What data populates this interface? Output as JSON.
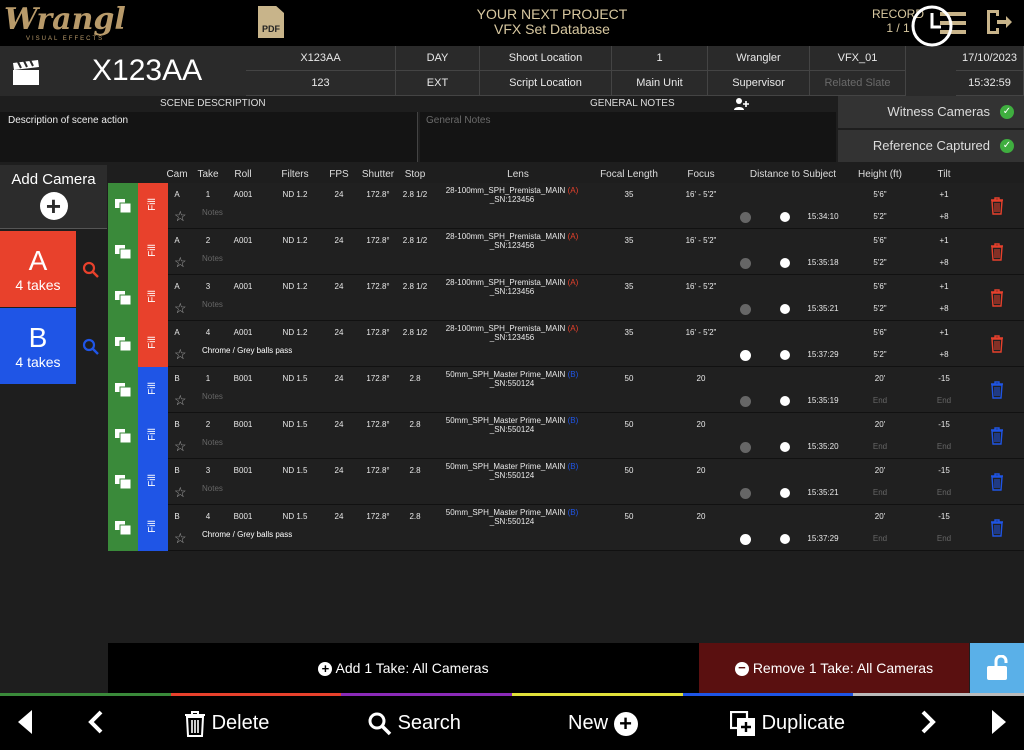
{
  "app": {
    "logo": "Wrangl",
    "logo_sub": "VISUAL EFFECTS",
    "pdf_label": "PDF",
    "project_line1": "YOUR NEXT PROJECT",
    "project_line2": "VFX Set Database",
    "record_label": "RECORD",
    "record_count": "1 / 1"
  },
  "scene": {
    "id": "X123AA",
    "row1": [
      "X123AA",
      "DAY",
      "Shoot Location",
      "1",
      "Wrangler",
      "VFX_01"
    ],
    "row2": [
      "123",
      "EXT",
      "Script Location",
      "Main Unit",
      "Supervisor",
      "Related Slate"
    ],
    "date": "17/10/2023",
    "time": "15:32:59",
    "scene_desc_header": "SCENE DESCRIPTION",
    "general_notes_header": "GENERAL NOTES",
    "scene_desc": "Description of scene action",
    "general_notes_placeholder": "General Notes",
    "witness": "Witness Cameras",
    "reference": "Reference Captured"
  },
  "sidebar": {
    "add_camera": "Add Camera",
    "cameras": [
      {
        "letter": "A",
        "takes": "4 takes",
        "color": "#e8412c"
      },
      {
        "letter": "B",
        "takes": "4 takes",
        "color": "#1f55e6"
      }
    ]
  },
  "columns": [
    "Cam",
    "Take",
    "Roll",
    "Filters",
    "FPS",
    "Shutter",
    "Stop",
    "Lens",
    "Focal Length",
    "Focus",
    "Distance to Subject",
    "Height (ft)",
    "Tilt"
  ],
  "fill_label": "Fill",
  "takes": [
    {
      "cam": "A",
      "take": "1",
      "roll": "A001",
      "filters": "ND 1.2",
      "fps": "24",
      "shutter": "172.8°",
      "stop": "2.8 1/2",
      "lens": "28-100mm_SPH_Premista_MAIN",
      "lens_tag": "(A)",
      "serial": "_SN:123456",
      "focal": "35",
      "focus": "16' - 5'2\"",
      "time": "15:34:10",
      "height_top": "5'6\"",
      "height_bot": "5'2\"",
      "tilt_top": "+1",
      "tilt_bot": "+8",
      "note": "Notes",
      "note_ghost": true
    },
    {
      "cam": "A",
      "take": "2",
      "roll": "A001",
      "filters": "ND 1.2",
      "fps": "24",
      "shutter": "172.8°",
      "stop": "2.8 1/2",
      "lens": "28-100mm_SPH_Premista_MAIN",
      "lens_tag": "(A)",
      "serial": "_SN:123456",
      "focal": "35",
      "focus": "16' - 5'2\"",
      "time": "15:35:18",
      "height_top": "5'6\"",
      "height_bot": "5'2\"",
      "tilt_top": "+1",
      "tilt_bot": "+8",
      "note": "Notes",
      "note_ghost": true
    },
    {
      "cam": "A",
      "take": "3",
      "roll": "A001",
      "filters": "ND 1.2",
      "fps": "24",
      "shutter": "172.8°",
      "stop": "2.8 1/2",
      "lens": "28-100mm_SPH_Premista_MAIN",
      "lens_tag": "(A)",
      "serial": "_SN:123456",
      "focal": "35",
      "focus": "16' - 5'2\"",
      "time": "15:35:21",
      "height_top": "5'6\"",
      "height_bot": "5'2\"",
      "tilt_top": "+1",
      "tilt_bot": "+8",
      "note": "Notes",
      "note_ghost": true
    },
    {
      "cam": "A",
      "take": "4",
      "roll": "A001",
      "filters": "ND 1.2",
      "fps": "24",
      "shutter": "172.8°",
      "stop": "2.8 1/2",
      "lens": "28-100mm_SPH_Premista_MAIN",
      "lens_tag": "(A)",
      "serial": "_SN:123456",
      "focal": "35",
      "focus": "16' - 5'2\"",
      "time": "15:37:29",
      "height_top": "5'6\"",
      "height_bot": "5'2\"",
      "tilt_top": "+1",
      "tilt_bot": "+8",
      "note": "Chrome / Grey balls pass",
      "note_ghost": false
    },
    {
      "cam": "B",
      "take": "1",
      "roll": "B001",
      "filters": "ND 1.5",
      "fps": "24",
      "shutter": "172.8°",
      "stop": "2.8",
      "lens": "50mm_SPH_Master Prime_MAIN",
      "lens_tag": "(B)",
      "serial": "_SN:550124",
      "focal": "50",
      "focus": "20",
      "time": "15:35:19",
      "height_top": "20'",
      "height_bot": "End",
      "tilt_top": "-15",
      "tilt_bot": "End",
      "note": "Notes",
      "note_ghost": true
    },
    {
      "cam": "B",
      "take": "2",
      "roll": "B001",
      "filters": "ND 1.5",
      "fps": "24",
      "shutter": "172.8°",
      "stop": "2.8",
      "lens": "50mm_SPH_Master Prime_MAIN",
      "lens_tag": "(B)",
      "serial": "_SN:550124",
      "focal": "50",
      "focus": "20",
      "time": "15:35:20",
      "height_top": "20'",
      "height_bot": "End",
      "tilt_top": "-15",
      "tilt_bot": "End",
      "note": "Notes",
      "note_ghost": true
    },
    {
      "cam": "B",
      "take": "3",
      "roll": "B001",
      "filters": "ND 1.5",
      "fps": "24",
      "shutter": "172.8°",
      "stop": "2.8",
      "lens": "50mm_SPH_Master Prime_MAIN",
      "lens_tag": "(B)",
      "serial": "_SN:550124",
      "focal": "50",
      "focus": "20",
      "time": "15:35:21",
      "height_top": "20'",
      "height_bot": "End",
      "tilt_top": "-15",
      "tilt_bot": "End",
      "note": "Notes",
      "note_ghost": true
    },
    {
      "cam": "B",
      "take": "4",
      "roll": "B001",
      "filters": "ND 1.5",
      "fps": "24",
      "shutter": "172.8°",
      "stop": "2.8",
      "lens": "50mm_SPH_Master Prime_MAIN",
      "lens_tag": "(B)",
      "serial": "_SN:550124",
      "focal": "50",
      "focus": "20",
      "time": "15:37:29",
      "height_top": "20'",
      "height_bot": "End",
      "tilt_top": "-15",
      "tilt_bot": "End",
      "note": "Chrome / Grey balls pass",
      "note_ghost": false
    }
  ],
  "actions": {
    "add_take": "Add 1 Take: All Cameras",
    "remove_take": "Remove 1 Take: All Cameras"
  },
  "bottom": {
    "delete": "Delete",
    "search": "Search",
    "new": "New",
    "duplicate": "Duplicate"
  },
  "colors": {
    "cam_a": "#e8412c",
    "cam_b": "#1f55e6",
    "copy_green": "#3a8a3a",
    "accent_gold": "#c8b48a",
    "remove_red": "#5a1010",
    "unlock_blue": "#5ab0e8"
  }
}
